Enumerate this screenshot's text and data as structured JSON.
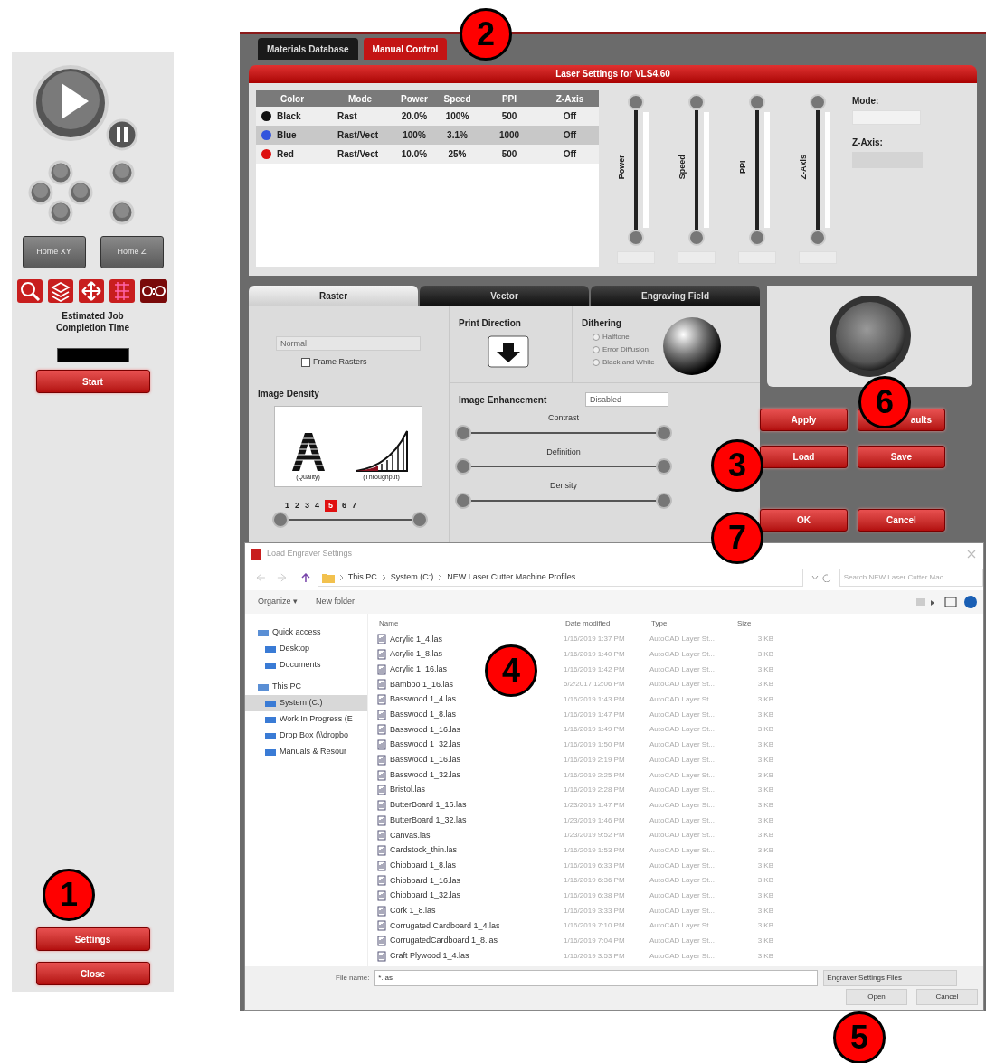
{
  "left_panel": {
    "home_buttons": [
      "Home XY",
      "Home Z"
    ],
    "estimate_label": "Estimated Job Completion Time",
    "start_button": "Start",
    "settings_button": "Settings",
    "close_button": "Close"
  },
  "window": {
    "tabs": [
      {
        "label": "Materials Database",
        "selected": false
      },
      {
        "label": "Manual Control",
        "selected": true
      }
    ],
    "header": "Laser Settings for VLS4.60",
    "table": {
      "columns": [
        "Color",
        "Mode",
        "Power",
        "Speed",
        "PPI",
        "Z-Axis"
      ],
      "rows": [
        {
          "color": "#111111",
          "selected": false,
          "cells": [
            "Black",
            "Rast",
            "20.0%",
            "100%",
            "500",
            "Off"
          ]
        },
        {
          "color": "#3355dd",
          "selected": true,
          "cells": [
            "Blue",
            "Rast/Vect",
            "100%",
            "3.1%",
            "1000",
            "Off"
          ]
        },
        {
          "color": "#dd1111",
          "selected": false,
          "cells": [
            "Red",
            "Rast/Vect",
            "10.0%",
            "25%",
            "500",
            "Off"
          ]
        }
      ]
    },
    "sliders": [
      "Power",
      "Speed",
      "PPI",
      "Z-Axis"
    ],
    "mode_label": "Mode:",
    "z_axis_label": "Z-Axis:",
    "mode_tabs": [
      {
        "label": "Raster",
        "selected": true
      },
      {
        "label": "Vector",
        "selected": false
      },
      {
        "label": "Engraving Field",
        "selected": false
      }
    ],
    "raster": {
      "quality_select": "Normal",
      "frame_rasters": {
        "label": "Frame Rasters",
        "checked": false
      },
      "image_density_label": "Image Density",
      "quality_caption": "(Quality)",
      "throughput_caption": "(Throughput)",
      "density_steps": [
        {
          "label": "1",
          "selected": false
        },
        {
          "label": "2",
          "selected": false
        },
        {
          "label": "3",
          "selected": false
        },
        {
          "label": "4",
          "selected": false
        },
        {
          "label": "5",
          "selected": true
        },
        {
          "label": "6",
          "selected": false
        },
        {
          "label": "7",
          "selected": false
        }
      ],
      "print_direction_label": "Print Direction",
      "dithering_label": "Dithering",
      "dithering_options": [
        {
          "label": "Halftone",
          "disabled": true,
          "checked": false
        },
        {
          "label": "Error Diffusion",
          "disabled": true,
          "checked": false
        },
        {
          "label": "Black and White",
          "disabled": true,
          "checked": false
        }
      ],
      "enhancement_label": "Image Enhancement",
      "enhancement_select": "Disabled",
      "enhancement_sliders": [
        "Contrast",
        "Definition",
        "Density"
      ]
    },
    "buttons": [
      "Apply",
      "aults",
      "Load",
      "Save",
      "OK",
      "Cancel"
    ]
  },
  "dialog": {
    "title": "Load Engraver Settings",
    "breadcrumb": [
      "This PC",
      "System (C:)",
      "NEW Laser Cutter Machine Profiles"
    ],
    "search_placeholder": "Search NEW Laser Cutter Mac...",
    "organize": "Organize ▾",
    "new_folder": "New folder",
    "nav": [
      {
        "label": "Quick access",
        "selected": false,
        "children": [
          {
            "label": "Desktop",
            "selected": false
          },
          {
            "label": "Documents",
            "selected": false
          }
        ]
      },
      {
        "label": "This PC",
        "selected": false,
        "children": [
          {
            "label": "System (C:)",
            "selected": true
          },
          {
            "label": "Work In Progress (E",
            "selected": false
          },
          {
            "label": "Drop Box (\\\\dropbo",
            "selected": false
          },
          {
            "label": "Manuals & Resour",
            "selected": false
          }
        ]
      }
    ],
    "columns": [
      "Name",
      "Date modified",
      "Type",
      "Size"
    ],
    "files": [
      [
        "Acrylic 1_4.las",
        "1/16/2019 1:37 PM",
        "AutoCAD Layer St...",
        "3 KB"
      ],
      [
        "Acrylic 1_8.las",
        "1/16/2019 1:40 PM",
        "AutoCAD Layer St...",
        "3 KB"
      ],
      [
        "Acrylic 1_16.las",
        "1/16/2019 1:42 PM",
        "AutoCAD Layer St...",
        "3 KB"
      ],
      [
        "Bamboo 1_16.las",
        "5/2/2017 12:06 PM",
        "AutoCAD Layer St...",
        "3 KB"
      ],
      [
        "Basswood 1_4.las",
        "1/16/2019 1:43 PM",
        "AutoCAD Layer St...",
        "3 KB"
      ],
      [
        "Basswood 1_8.las",
        "1/16/2019 1:47 PM",
        "AutoCAD Layer St...",
        "3 KB"
      ],
      [
        "Basswood 1_16.las",
        "1/16/2019 1:49 PM",
        "AutoCAD Layer St...",
        "3 KB"
      ],
      [
        "Basswood 1_32.las",
        "1/16/2019 1:50 PM",
        "AutoCAD Layer St...",
        "3 KB"
      ],
      [
        "Basswood 1_16.las",
        "1/16/2019 2:19 PM",
        "AutoCAD Layer St...",
        "3 KB"
      ],
      [
        "Basswood 1_32.las",
        "1/16/2019 2:25 PM",
        "AutoCAD Layer St...",
        "3 KB"
      ],
      [
        "Bristol.las",
        "1/16/2019 2:28 PM",
        "AutoCAD Layer St...",
        "3 KB"
      ],
      [
        "ButterBoard 1_16.las",
        "1/23/2019 1:47 PM",
        "AutoCAD Layer St...",
        "3 KB"
      ],
      [
        "ButterBoard 1_32.las",
        "1/23/2019 1:46 PM",
        "AutoCAD Layer St...",
        "3 KB"
      ],
      [
        "Canvas.las",
        "1/23/2019 9:52 PM",
        "AutoCAD Layer St...",
        "3 KB"
      ],
      [
        "Cardstock_thin.las",
        "1/16/2019 1:53 PM",
        "AutoCAD Layer St...",
        "3 KB"
      ],
      [
        "Chipboard 1_8.las",
        "1/16/2019 6:33 PM",
        "AutoCAD Layer St...",
        "3 KB"
      ],
      [
        "Chipboard 1_16.las",
        "1/16/2019 6:36 PM",
        "AutoCAD Layer St...",
        "3 KB"
      ],
      [
        "Chipboard 1_32.las",
        "1/16/2019 6:38 PM",
        "AutoCAD Layer St...",
        "3 KB"
      ],
      [
        "Cork 1_8.las",
        "1/16/2019 3:33 PM",
        "AutoCAD Layer St...",
        "3 KB"
      ],
      [
        "Corrugated Cardboard 1_4.las",
        "1/16/2019 7:10 PM",
        "AutoCAD Layer St...",
        "3 KB"
      ],
      [
        "CorrugatedCardboard 1_8.las",
        "1/16/2019 7:04 PM",
        "AutoCAD Layer St...",
        "3 KB"
      ],
      [
        "Craft Plywood 1_4.las",
        "1/16/2019 3:53 PM",
        "AutoCAD Layer St...",
        "3 KB"
      ]
    ],
    "file_name_label": "File name:",
    "file_name": "*.las",
    "file_type": "Engraver Settings Files",
    "open_button": "Open",
    "cancel_button": "Cancel"
  },
  "callouts": [
    "1",
    "2",
    "3",
    "4",
    "5",
    "6",
    "7"
  ]
}
